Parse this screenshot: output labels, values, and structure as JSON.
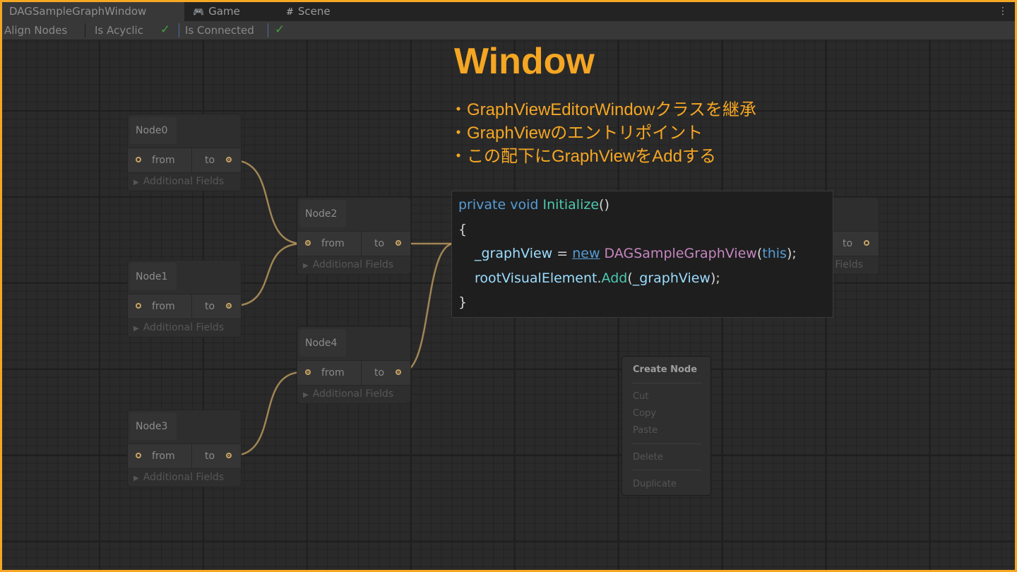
{
  "tabs": [
    {
      "label": "DAGSampleGraphWindow",
      "icon": ""
    },
    {
      "label": "Game",
      "icon": "gamepad-icon"
    },
    {
      "label": "Scene",
      "icon": "grid-icon"
    }
  ],
  "tab_menu_icon": "kebab-menu-icon",
  "toolbar": {
    "align_nodes": "Align Nodes",
    "is_acyclic": "Is Acyclic",
    "is_connected": "Is Connected",
    "acyclic_checked": true,
    "connected_checked": true
  },
  "nodes": [
    {
      "title": "Node0",
      "input": "from",
      "output": "to",
      "additional": "Additional Fields"
    },
    {
      "title": "Node1",
      "input": "from",
      "output": "to",
      "additional": "Additional Fields"
    },
    {
      "title": "Node2",
      "input": "from",
      "output": "to",
      "additional": "Additional Fields"
    },
    {
      "title": "Node3",
      "input": "from",
      "output": "to",
      "additional": "Additional Fields"
    },
    {
      "title": "Node4",
      "input": "from",
      "output": "to",
      "additional": "Additional Fields"
    },
    {
      "title": "",
      "input": "",
      "output": "to",
      "additional": "l Fields"
    }
  ],
  "annotation": {
    "title": "Window",
    "bullets": [
      "・GraphViewEditorWindowクラスを継承",
      "・GraphViewのエントリポイント",
      "・この配下にGraphViewをAddする"
    ]
  },
  "code": {
    "l1": {
      "a": "private",
      "b": " ",
      "c": "void",
      "d": " ",
      "e": "Initialize",
      "f": "()"
    },
    "l2": "{",
    "l3": {
      "a": "_graphView",
      "b": " = ",
      "c": "new",
      "d": " ",
      "e": "DAGSampleGraphView",
      "f": "(",
      "g": "this",
      "h": ");"
    },
    "l4": {
      "a": "rootVisualElement",
      "b": ".",
      "c": "Add",
      "d": "(",
      "e": "_graphView",
      "f": ");"
    },
    "l5": "}"
  },
  "context_menu": {
    "create_node": "Create Node",
    "cut": "Cut",
    "copy": "Copy",
    "paste": "Paste",
    "delete": "Delete",
    "duplicate": "Duplicate"
  },
  "colors": {
    "accent": "#f5a623",
    "edge": "#c9a463",
    "check": "#3f9f3f"
  }
}
